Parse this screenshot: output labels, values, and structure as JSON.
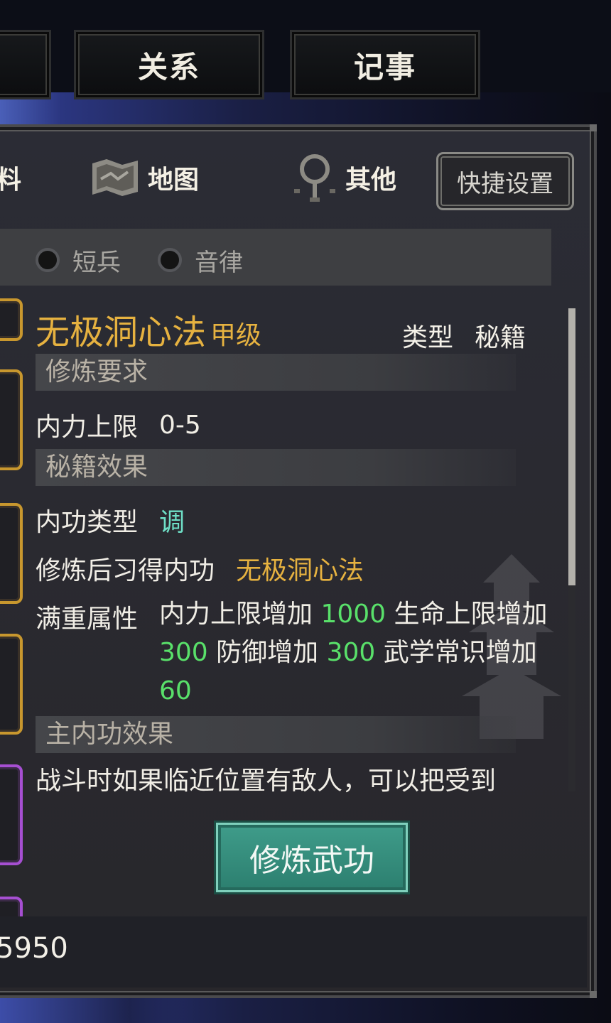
{
  "top_tabs": [
    {
      "label": ""
    },
    {
      "label": "关系"
    },
    {
      "label": "记事"
    }
  ],
  "nav": {
    "partial_label": "料",
    "map_label": "地图",
    "other_label": "其他",
    "shortcut_label": "快捷设置"
  },
  "filters": [
    {
      "label": "短兵"
    },
    {
      "label": "音律"
    }
  ],
  "detail": {
    "name": "无极洞心法",
    "grade": "甲级",
    "type_label": "类型",
    "type_value": "秘籍",
    "sections": {
      "requirement": "修炼要求",
      "effect": "秘籍效果",
      "main_effect": "主内功效果"
    },
    "requirement_label": "内力上限",
    "requirement_value": "0-5",
    "skill_type_label": "内功类型",
    "skill_type_value": "调",
    "learned_label": "修炼后习得内功",
    "learned_value": "无极洞心法",
    "attr_label": "满重属性",
    "attr": {
      "t1": "内力上限增加 ",
      "v1": "1000",
      "t2": " 生命上限增加 ",
      "v2": "300",
      "t3": " 防御增加 ",
      "v3": "300",
      "t4": " 武学常识增加 ",
      "v4": "60"
    },
    "main_effect_text": "战斗时如果临近位置有敌人，可以把受到"
  },
  "train_button": "修炼武功",
  "footer_value": "5950",
  "colors": {
    "gold": "#e6b240",
    "green": "#59e06a",
    "cyan": "#6fe0c7",
    "button_teal": "#3f9c8a",
    "card_gold": "#c8972e",
    "card_purple": "#a64fd2"
  },
  "icons": [
    "map-icon",
    "other-icon"
  ]
}
